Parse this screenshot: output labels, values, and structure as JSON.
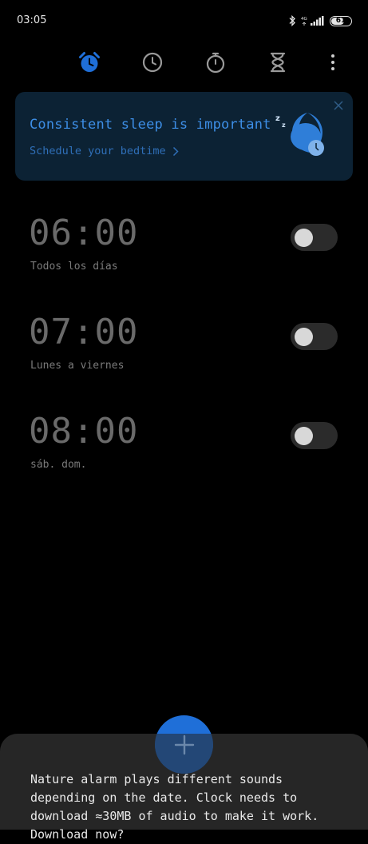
{
  "status_bar": {
    "time": "03:05",
    "battery": "61"
  },
  "tabs": [
    {
      "name": "alarm",
      "active": true
    },
    {
      "name": "clock",
      "active": false
    },
    {
      "name": "stopwatch",
      "active": false
    },
    {
      "name": "timer",
      "active": false
    }
  ],
  "banner": {
    "title": "Consistent sleep is important",
    "link": "Schedule your bedtime"
  },
  "alarms": [
    {
      "time": "06:00",
      "repeat": "Todos los días",
      "enabled": false
    },
    {
      "time": "07:00",
      "repeat": "Lunes a viernes",
      "enabled": false
    },
    {
      "time": "08:00",
      "repeat": "sáb. dom.",
      "enabled": false
    }
  ],
  "sheet": {
    "message": "Nature alarm plays different sounds depending on the date. Clock needs to download ≈30MB of audio to make it work. Download now?"
  },
  "colors": {
    "accent": "#1f6fd8",
    "banner_bg": "#0c2234",
    "banner_text": "#3d8ee6"
  }
}
